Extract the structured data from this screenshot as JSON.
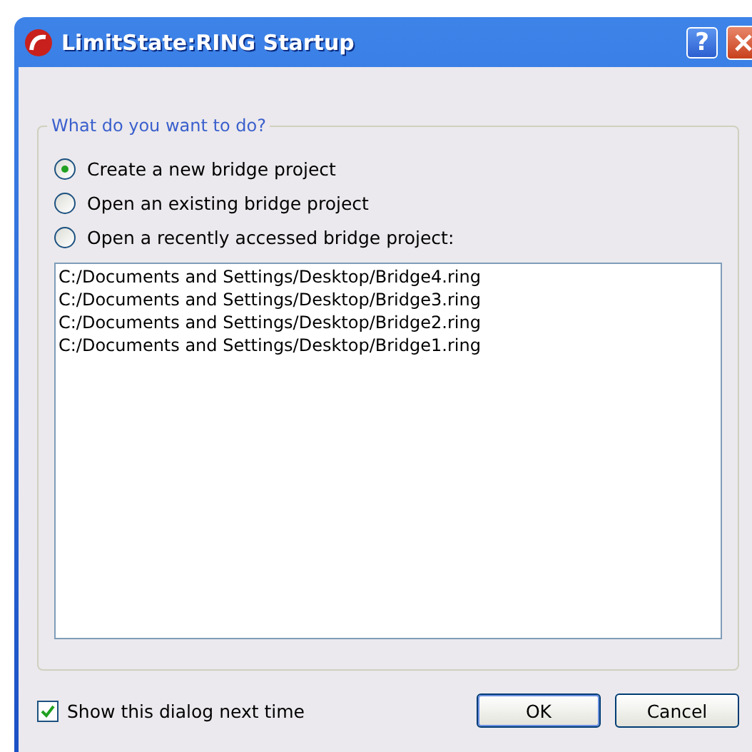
{
  "window": {
    "title": "LimitState:RING Startup",
    "help_button": "?"
  },
  "group": {
    "title": "What do you want to do?",
    "options": [
      {
        "label": "Create a new bridge project",
        "selected": true
      },
      {
        "label": "Open an existing bridge project",
        "selected": false
      },
      {
        "label": "Open a recently accessed bridge project:",
        "selected": false
      }
    ],
    "recent_files": [
      "C:/Documents and Settings/Desktop/Bridge4.ring",
      "C:/Documents and Settings/Desktop/Bridge3.ring",
      "C:/Documents and Settings/Desktop/Bridge2.ring",
      "C:/Documents and Settings/Desktop/Bridge1.ring"
    ]
  },
  "show_next_time": {
    "label": "Show this dialog next time",
    "checked": true
  },
  "buttons": [
    "OK",
    "Cancel"
  ]
}
